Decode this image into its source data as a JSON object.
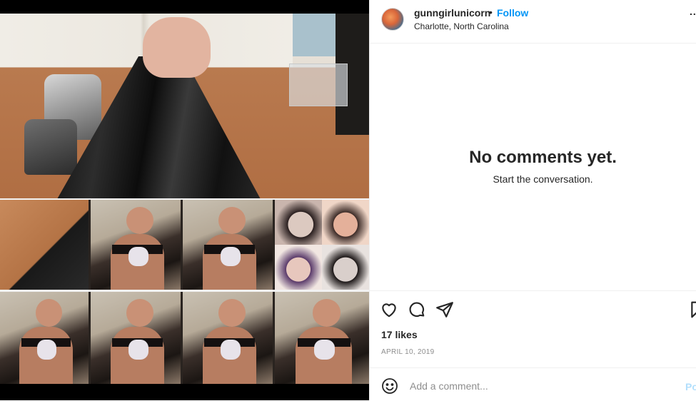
{
  "post": {
    "username": "gunngirlunicorn",
    "separator": "•",
    "follow_label": "Follow",
    "location": "Charlotte, North Carolina",
    "more_label": "..."
  },
  "comments": {
    "empty_title": "No comments yet.",
    "empty_subtitle": "Start the conversation."
  },
  "actions": {
    "icons": [
      "heart-icon",
      "comment-icon",
      "share-icon",
      "bookmark-icon"
    ],
    "likes": "17 likes",
    "date": "APRIL 10, 2019"
  },
  "comment_box": {
    "placeholder": "Add a comment...",
    "post_label": "Post",
    "emoji_icon": "emoji-icon"
  },
  "colors": {
    "accent": "#0095f6",
    "post_disabled": "#b2dffc",
    "text": "#262626",
    "muted": "#8e8e8e",
    "divider": "#efefef"
  }
}
